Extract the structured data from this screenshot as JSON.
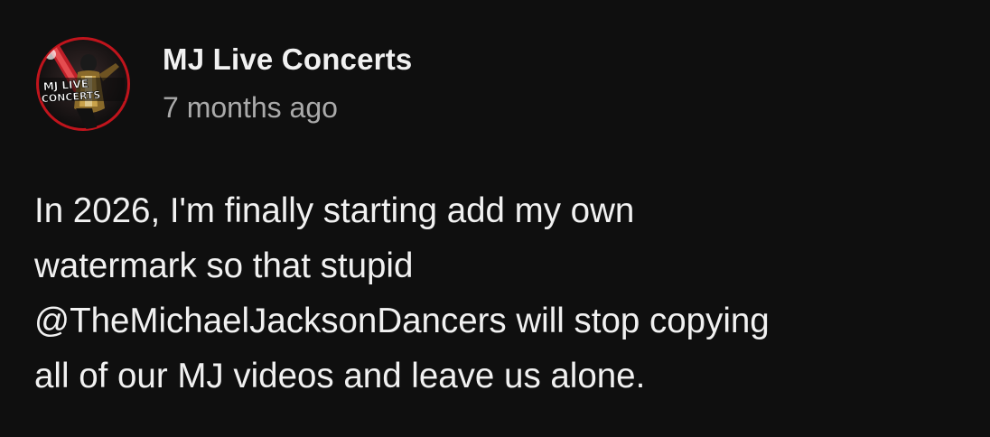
{
  "post": {
    "channel_name": "MJ Live Concerts",
    "timestamp": "7 months ago",
    "avatar": {
      "icon": "channel-avatar-icon",
      "logo_text": [
        "MJ LIVE",
        "CONCERTS"
      ]
    },
    "body_lines": [
      "In 2026, I'm finally starting add my own",
      "watermark so that stupid",
      "@TheMichaelJacksonDancers will stop copying",
      "all of our MJ videos and leave us alone."
    ]
  },
  "colors": {
    "background": "#0f0f0f",
    "primary_text": "#f1f1f1",
    "secondary_text": "#aaaaaa",
    "avatar_ring": "#c0141c"
  }
}
